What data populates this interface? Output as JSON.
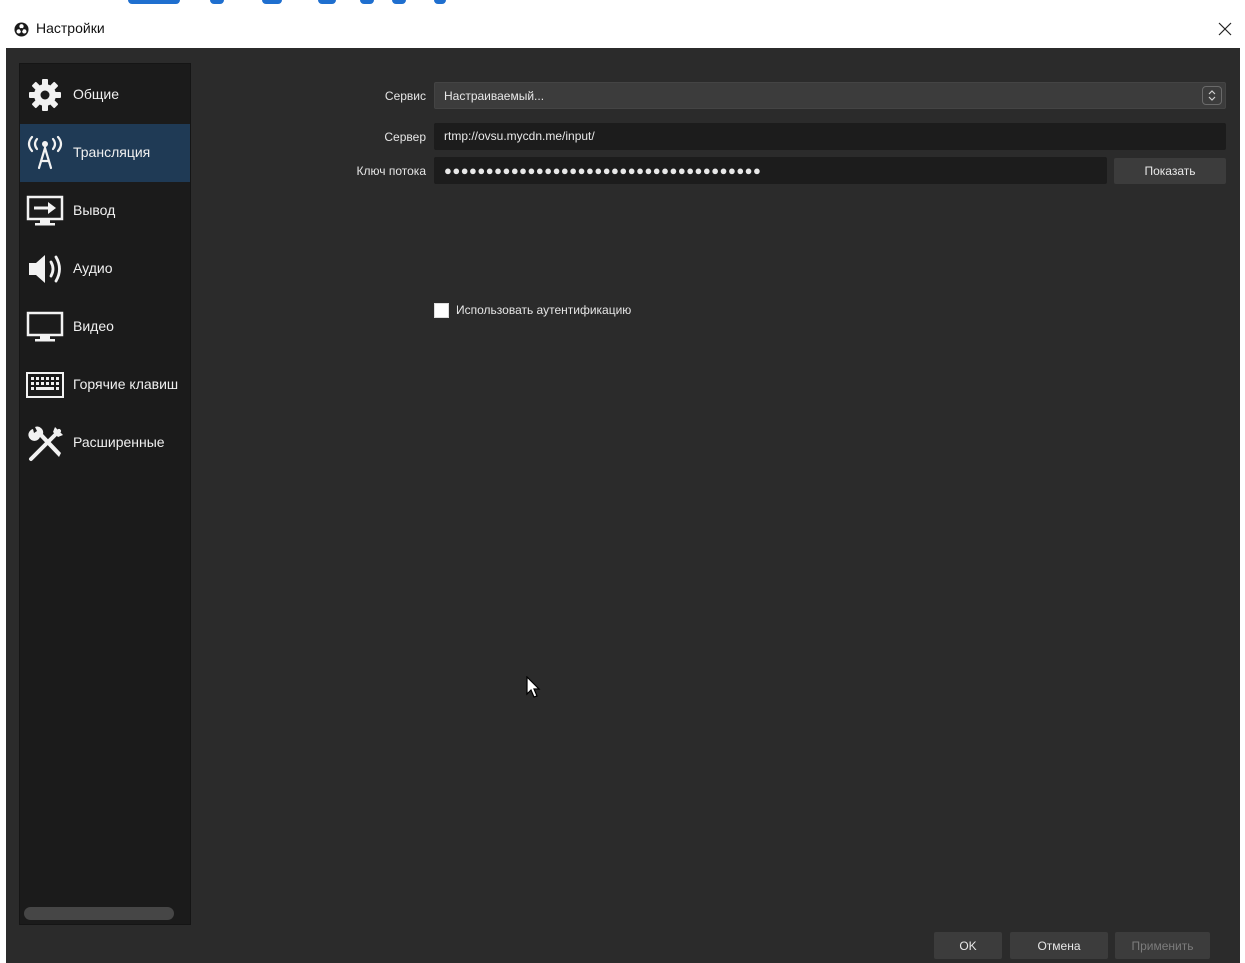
{
  "window": {
    "title": "Настройки",
    "close_glyph": "✕"
  },
  "sidebar": {
    "items": [
      {
        "label": "Общие",
        "icon": "gear-icon"
      },
      {
        "label": "Трансляция",
        "icon": "broadcast-antenna-icon",
        "active": true
      },
      {
        "label": "Вывод",
        "icon": "output-monitor-icon"
      },
      {
        "label": "Аудио",
        "icon": "speaker-icon"
      },
      {
        "label": "Видео",
        "icon": "monitor-icon"
      },
      {
        "label": "Горячие клавиш",
        "icon": "keyboard-icon"
      },
      {
        "label": "Расширенные",
        "icon": "tools-icon"
      }
    ]
  },
  "stream": {
    "service_label": "Сервис",
    "service_value": "Настраиваемый...",
    "server_label": "Сервер",
    "server_value": "rtmp://ovsu.mycdn.me/input/",
    "key_label": "Ключ потока",
    "key_value": "●●●●●●●●●●●●●●●●●●●●●●●●●●●●●●●●●●●●●●",
    "show_button": "Показать",
    "auth_label": "Использовать аутентификацию",
    "auth_checked": false
  },
  "footer": {
    "ok": "OK",
    "cancel": "Отмена",
    "apply": "Применить"
  },
  "colors": {
    "accent": "#1f3a55",
    "background": "#2b2b2b",
    "sidebar": "#1b1b1b"
  }
}
